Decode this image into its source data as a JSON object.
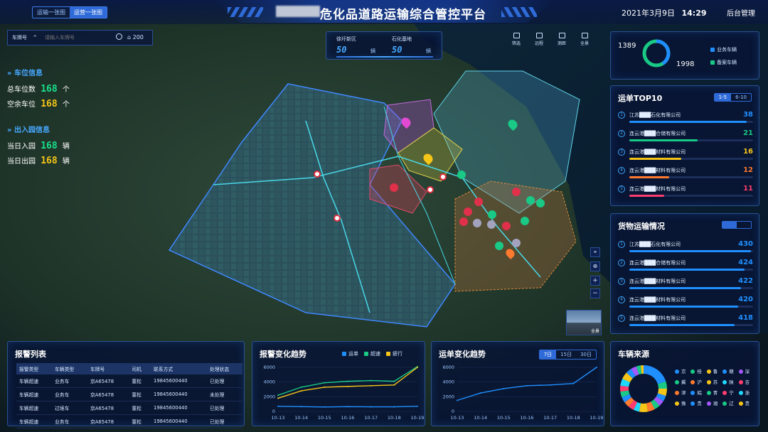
{
  "header": {
    "tab_left": "运输一张图",
    "tab_right": "运营一张图",
    "title": "危化品道路运输综合管控平台",
    "date": "2021年3月9日",
    "time": "14:29",
    "admin": "后台管理"
  },
  "search": {
    "field_label": "车牌号",
    "placeholder": "请输入车牌号",
    "count": "200"
  },
  "parking": {
    "section1_title": "车位信息",
    "total_label": "总车位数",
    "total_value": "168",
    "total_unit": "个",
    "free_label": "空余车位",
    "free_value": "168",
    "free_unit": "个",
    "section2_title": "出入园信息",
    "in_label": "当日入园",
    "in_value": "168",
    "in_unit": "辆",
    "out_label": "当日出园",
    "out_value": "168",
    "out_unit": "辆"
  },
  "center_stats": {
    "s1_label": "徐圩新区",
    "s1_value": "50",
    "s1_unit": "辆",
    "s2_label": "石化基地",
    "s2_value": "50",
    "s2_unit": "辆"
  },
  "tools": [
    "筛选",
    "远程",
    "测距",
    "全景"
  ],
  "zoom": {
    "panorama_label": "全景"
  },
  "vehicle_summary": {
    "left_value": "1389",
    "right_value": "1998",
    "legend_a": "业务车辆",
    "legend_b": "备案车辆",
    "color_a": "#1f8fff",
    "color_b": "#19c985",
    "fraction_a": 0.41
  },
  "top10": {
    "title": "运单TOP10",
    "tab_a": "1-5",
    "tab_b": "6-10",
    "rows": [
      {
        "rank": "1",
        "name": "江苏███石化有限公司",
        "value": "38",
        "color": "#1f8fff",
        "frac": 0.95
      },
      {
        "rank": "2",
        "name": "连云港███仓储有限公司",
        "value": "21",
        "color": "#19c985",
        "frac": 0.55
      },
      {
        "rank": "3",
        "name": "连云港███材料有限公司",
        "value": "16",
        "color": "#f5c518",
        "frac": 0.42
      },
      {
        "rank": "4",
        "name": "连云港███材料有限公司",
        "value": "12",
        "color": "#ff7a2e",
        "frac": 0.32
      },
      {
        "rank": "5",
        "name": "连云港███材料有限公司",
        "value": "11",
        "color": "#ff3d6e",
        "frac": 0.28
      }
    ]
  },
  "cargo": {
    "title": "货物运输情况",
    "tab_a": "",
    "tab_b": "",
    "rows": [
      {
        "rank": "1",
        "name": "江苏███石化有限公司",
        "value": "430",
        "frac": 0.98
      },
      {
        "rank": "2",
        "name": "连云港███仓储有限公司",
        "value": "424",
        "frac": 0.93
      },
      {
        "rank": "3",
        "name": "连云港███材料有限公司",
        "value": "422",
        "frac": 0.9
      },
      {
        "rank": "4",
        "name": "连云港███材料有限公司",
        "value": "420",
        "frac": 0.88
      },
      {
        "rank": "5",
        "name": "连云港███材料有限公司",
        "value": "418",
        "frac": 0.85
      }
    ]
  },
  "alarm_table": {
    "title": "报警列表",
    "headers": [
      "报警类型",
      "车辆类型",
      "车牌号",
      "司机",
      "联系方式",
      "处理状态"
    ],
    "rows": [
      [
        "车辆超速",
        "业务车",
        "京A65478",
        "董松",
        "19845600440",
        "已处理"
      ],
      [
        "车辆超速",
        "业务车",
        "京A65478",
        "董松",
        "19845600440",
        "未处理"
      ],
      [
        "车辆超速",
        "过境车",
        "京A65478",
        "董松",
        "19845600440",
        "已处理"
      ],
      [
        "车辆超速",
        "业务车",
        "京A65478",
        "董松",
        "19845600440",
        "已处理"
      ]
    ]
  },
  "alarm_trend": {
    "title": "报警变化趋势",
    "colors": [
      "#1f8fff",
      "#19c985",
      "#f5c518"
    ]
  },
  "waybill_trend": {
    "title": "运单变化趋势",
    "tabs": [
      "7日",
      "15日",
      "30日"
    ]
  },
  "vehicle_source": {
    "title": "车辆来源",
    "items": [
      {
        "name": "京",
        "color": "#1f8fff"
      },
      {
        "name": "桂",
        "color": "#19c985"
      },
      {
        "name": "鲁",
        "color": "#f5c518"
      },
      {
        "name": "赣",
        "color": "#1f8fff"
      },
      {
        "name": "深",
        "color": "#a259ff"
      },
      {
        "name": "冀",
        "color": "#19c985"
      },
      {
        "name": "沪",
        "color": "#ff7a2e"
      },
      {
        "name": "苏",
        "color": "#f5c518"
      },
      {
        "name": "陕",
        "color": "#1fd8ff"
      },
      {
        "name": "吉",
        "color": "#ff3d6e"
      },
      {
        "name": "津",
        "color": "#ff7a2e"
      },
      {
        "name": "皖",
        "color": "#1f8fff"
      },
      {
        "name": "青",
        "color": "#19c985"
      },
      {
        "name": "宁",
        "color": "#ff3d6e"
      },
      {
        "name": "浙",
        "color": "#1fd8ff"
      },
      {
        "name": "豫",
        "color": "#f5c518"
      },
      {
        "name": "贵",
        "color": "#1f8fff"
      },
      {
        "name": "湘",
        "color": "#a259ff"
      },
      {
        "name": "辽",
        "color": "#19c985"
      },
      {
        "name": "贵",
        "color": "#f5c518"
      }
    ]
  },
  "chart_data": [
    {
      "type": "line",
      "title": "报警变化趋势",
      "categories": [
        "10-13",
        "10-14",
        "10-15",
        "10-16",
        "10-17",
        "10-18",
        "10-19"
      ],
      "ylim": [
        0,
        6000
      ],
      "yticks": [
        "0",
        "2000",
        "4000",
        "6000"
      ],
      "series": [
        {
          "name": "运单",
          "values": [
            700,
            650,
            600,
            650,
            620,
            620,
            700
          ],
          "color": "#1f8fff"
        },
        {
          "name": "超速",
          "values": [
            2200,
            3300,
            3900,
            4100,
            4200,
            4100,
            6100
          ],
          "color": "#19c985"
        },
        {
          "name": "疲行",
          "values": [
            1800,
            2800,
            3300,
            3400,
            3500,
            3600,
            6000
          ],
          "color": "#f5c518"
        }
      ]
    },
    {
      "type": "line",
      "title": "运单变化趋势",
      "categories": [
        "10-13",
        "10-14",
        "10-15",
        "10-16",
        "10-17",
        "10-18",
        "10-19"
      ],
      "ylim": [
        0,
        6000
      ],
      "yticks": [
        "0",
        "2000",
        "4000",
        "6000"
      ],
      "series": [
        {
          "name": "",
          "values": [
            1500,
            2500,
            3100,
            3500,
            3600,
            3800,
            6000
          ],
          "color": "#1f8fff"
        }
      ]
    },
    {
      "type": "pie",
      "title": "车辆来源",
      "categories": [
        "京",
        "桂",
        "鲁",
        "赣",
        "深",
        "冀",
        "沪",
        "苏",
        "陕",
        "吉",
        "津",
        "皖",
        "青",
        "宁",
        "浙",
        "豫",
        "贵",
        "湘",
        "辽",
        "贵"
      ],
      "values": [
        20,
        5,
        5,
        4,
        4,
        4,
        5,
        6,
        4,
        4,
        4,
        4,
        4,
        4,
        5,
        5,
        4,
        4,
        3,
        2
      ]
    }
  ]
}
